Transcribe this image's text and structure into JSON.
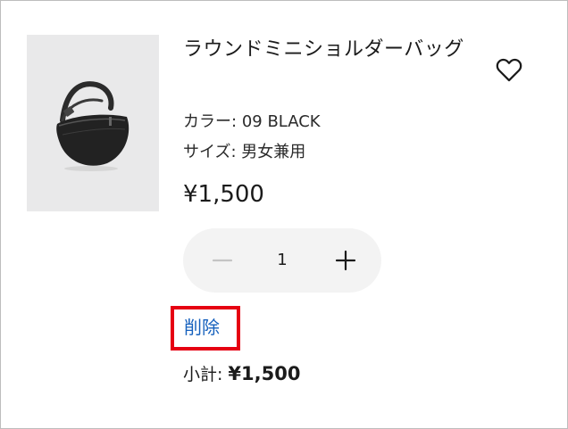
{
  "product": {
    "name": "ラウンドミニショルダーバッグ",
    "image_icon": "shoulder-bag-image",
    "color_label": "カラー:",
    "color_value": "09 BLACK",
    "size_label": "サイズ:",
    "size_value": "男女兼用",
    "price": "¥1,500"
  },
  "favorite": {
    "icon": "heart-outline-icon"
  },
  "quantity": {
    "value": "1",
    "minus_icon": "minus-icon",
    "plus_icon": "plus-icon",
    "minus_disabled": true
  },
  "actions": {
    "delete_label": "削除",
    "highlight_color": "#e60012",
    "link_color": "#1560bd"
  },
  "subtotal": {
    "label": "小計:",
    "amount": "¥1,500"
  }
}
